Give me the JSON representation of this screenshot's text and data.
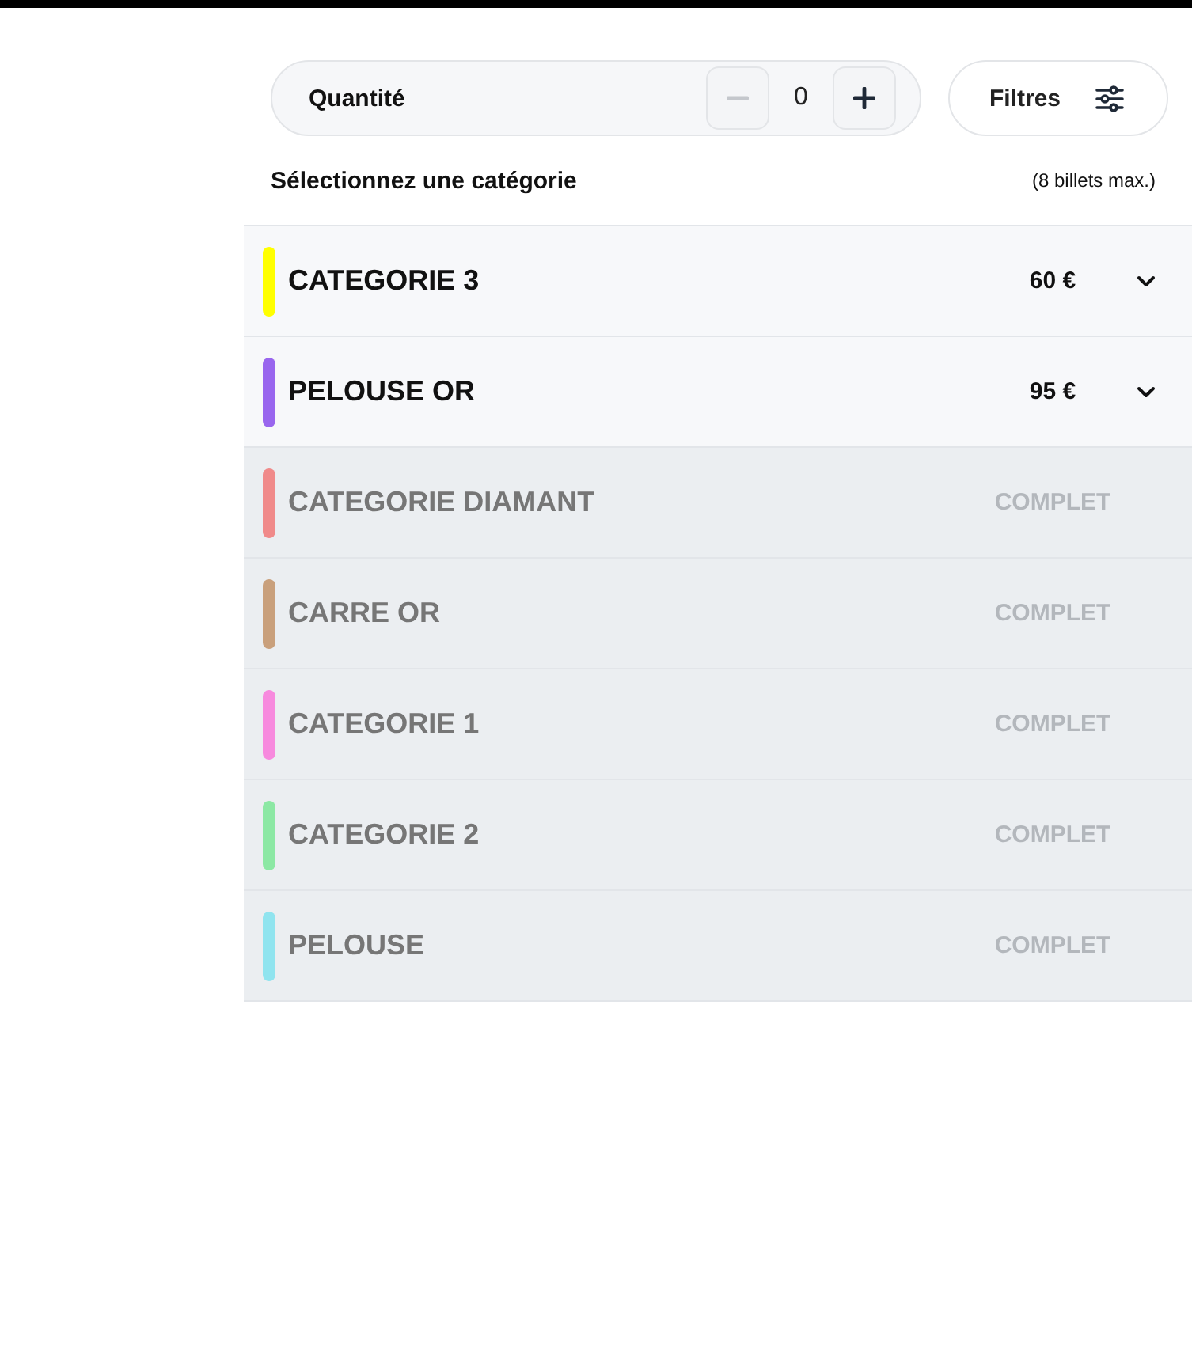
{
  "quantity": {
    "label": "Quantité",
    "value": "0",
    "decrement": {
      "disabled": true
    },
    "increment": {
      "disabled": false
    }
  },
  "filters_button": {
    "label": "Filtres"
  },
  "category_header": {
    "title": "Sélectionnez une catégorie",
    "note": "(8 billets max.)"
  },
  "categories": [
    {
      "kind": "available",
      "name": "CATEGORIE 3",
      "color": "#ffff00",
      "price": "60 €"
    },
    {
      "kind": "available",
      "name": "PELOUSE OR",
      "color": "#9966ee",
      "price": "95 €"
    },
    {
      "kind": "sold_out",
      "name": "CATEGORIE DIAMANT",
      "color": "#f08a8a",
      "status": "COMPLET"
    },
    {
      "kind": "sold_out",
      "name": "CARRE OR",
      "color": "#c9a07c",
      "status": "COMPLET"
    },
    {
      "kind": "sold_out",
      "name": "CATEGORIE 1",
      "color": "#f78ade",
      "status": "COMPLET"
    },
    {
      "kind": "sold_out",
      "name": "CATEGORIE 2",
      "color": "#8ce8a4",
      "status": "COMPLET"
    },
    {
      "kind": "sold_out",
      "name": "PELOUSE",
      "color": "#90e4ef",
      "status": "COMPLET"
    }
  ]
}
